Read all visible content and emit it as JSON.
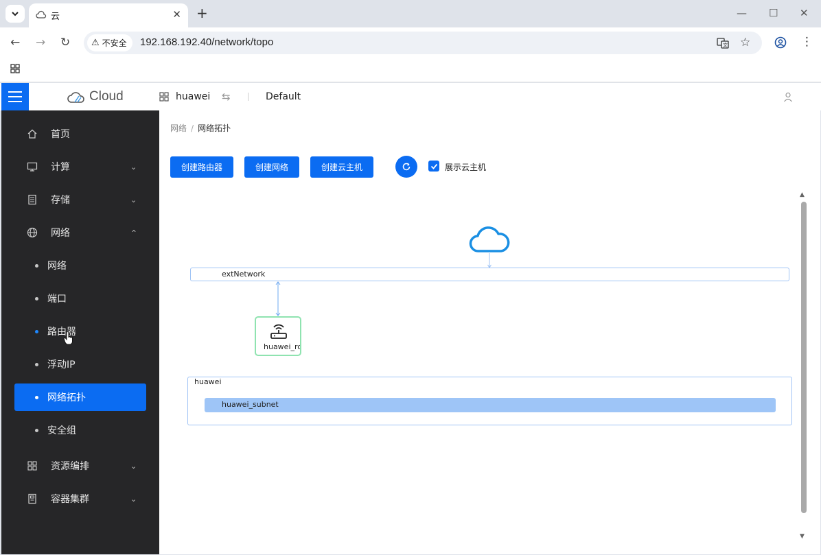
{
  "browser": {
    "tab_title": "云",
    "url": "192.168.192.40/network/topo",
    "security_label": "不安全"
  },
  "header": {
    "logo_text": "Cloud",
    "project_name": "huawei",
    "domain_name": "Default"
  },
  "sidebar": {
    "items": [
      {
        "label": "首页",
        "icon": "home-icon"
      },
      {
        "label": "计算",
        "icon": "monitor-icon"
      },
      {
        "label": "存储",
        "icon": "storage-icon"
      },
      {
        "label": "网络",
        "icon": "globe-icon"
      },
      {
        "label": "资源编排",
        "icon": "grid-icon"
      },
      {
        "label": "容器集群",
        "icon": "container-icon"
      }
    ],
    "network_sub": [
      {
        "label": "网络"
      },
      {
        "label": "端口"
      },
      {
        "label": "路由器"
      },
      {
        "label": "浮动IP"
      },
      {
        "label": "网络拓扑"
      },
      {
        "label": "安全组"
      }
    ]
  },
  "breadcrumb": {
    "parent": "网络",
    "current": "网络拓扑",
    "separator": "/"
  },
  "toolbar": {
    "create_router": "创建路由器",
    "create_network": "创建网络",
    "create_instance": "创建云主机",
    "show_instances_label": "展示云主机",
    "show_instances_checked": true
  },
  "topology": {
    "external_network": "extNetwork",
    "router_label": "huawei_rc",
    "network_name": "huawei",
    "subnet_name": "huawei_subnet"
  },
  "colors": {
    "primary": "#0b6cf2",
    "sidebar_bg": "#262628",
    "router_border": "#8fe3b0",
    "subnet_fill": "#9ec5f7",
    "cloud": "#1a8fe3"
  }
}
